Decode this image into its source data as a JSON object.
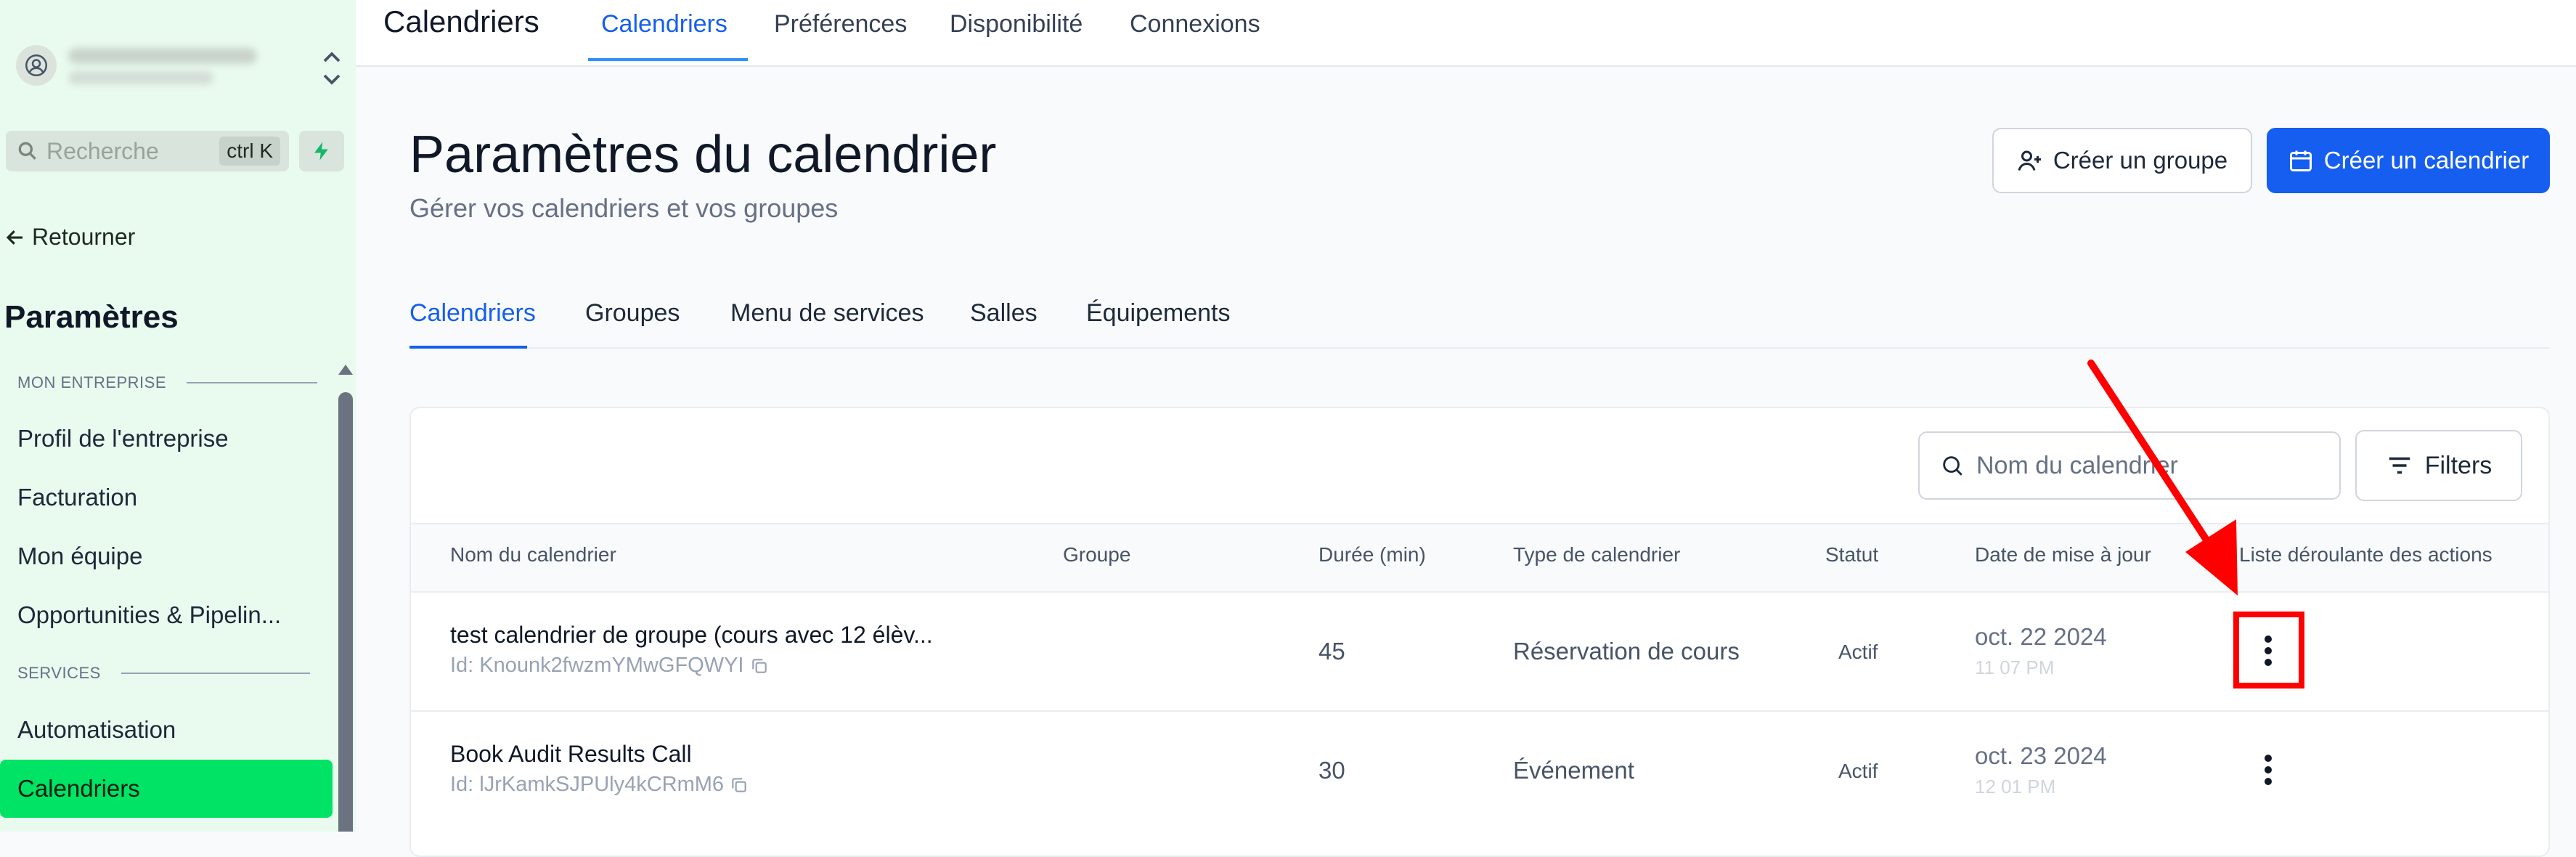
{
  "sidebar": {
    "search": {
      "placeholder": "Recherche",
      "shortcut": "ctrl K"
    },
    "back_label": "Retourner",
    "title": "Paramètres",
    "sections": [
      {
        "label": "MON ENTREPRISE",
        "items": [
          "Profil de l'entreprise",
          "Facturation",
          "Mon équipe",
          "Opportunities & Pipelin..."
        ]
      },
      {
        "label": "SERVICES",
        "items": [
          "Automatisation",
          "Calendriers"
        ]
      }
    ],
    "active_item": "Calendriers"
  },
  "topnav": {
    "title": "Calendriers",
    "tabs": [
      "Calendriers",
      "Préférences",
      "Disponibilité",
      "Connexions"
    ],
    "active_tab": "Calendriers"
  },
  "page": {
    "title": "Paramètres du calendrier",
    "subtitle": "Gérer vos calendriers et vos groupes",
    "create_group_label": "Créer un groupe",
    "create_calendar_label": "Créer un calendrier"
  },
  "subtabs": {
    "items": [
      "Calendriers",
      "Groupes",
      "Menu de services",
      "Salles",
      "Équipements"
    ],
    "active": "Calendriers"
  },
  "table": {
    "search_placeholder": "Nom du calendrier",
    "filters_label": "Filters",
    "columns": [
      "Nom du calendrier",
      "Groupe",
      "Durée (min)",
      "Type de calendrier",
      "Statut",
      "Date de mise à jour",
      "Liste déroulante des actions"
    ],
    "rows": [
      {
        "name": "test calendrier de groupe (cours avec 12 élèv...",
        "id": "Id: Knounk2fwzmYMwGFQWYI",
        "group": "",
        "duration": "45",
        "type": "Réservation de cours",
        "status": "Actif",
        "date": "oct. 22 2024",
        "time": "11 07 PM"
      },
      {
        "name": "Book Audit Results Call",
        "id": "Id: lJrKamkSJPUly4kCRmM6",
        "group": "",
        "duration": "30",
        "type": "Événement",
        "status": "Actif",
        "date": "oct. 23 2024",
        "time": "12 01 PM"
      }
    ]
  },
  "colors": {
    "sidebar_bg": "#e9fbee",
    "active_nav": "#00e364",
    "primary": "#155eef",
    "annotation": "#ff0000"
  },
  "icons": [
    "user-icon",
    "chevrons-updown-icon",
    "search-icon",
    "bolt-icon",
    "arrow-left-icon",
    "user-plus-icon",
    "calendar-icon",
    "filter-icon",
    "copy-icon",
    "kebab-icon"
  ]
}
